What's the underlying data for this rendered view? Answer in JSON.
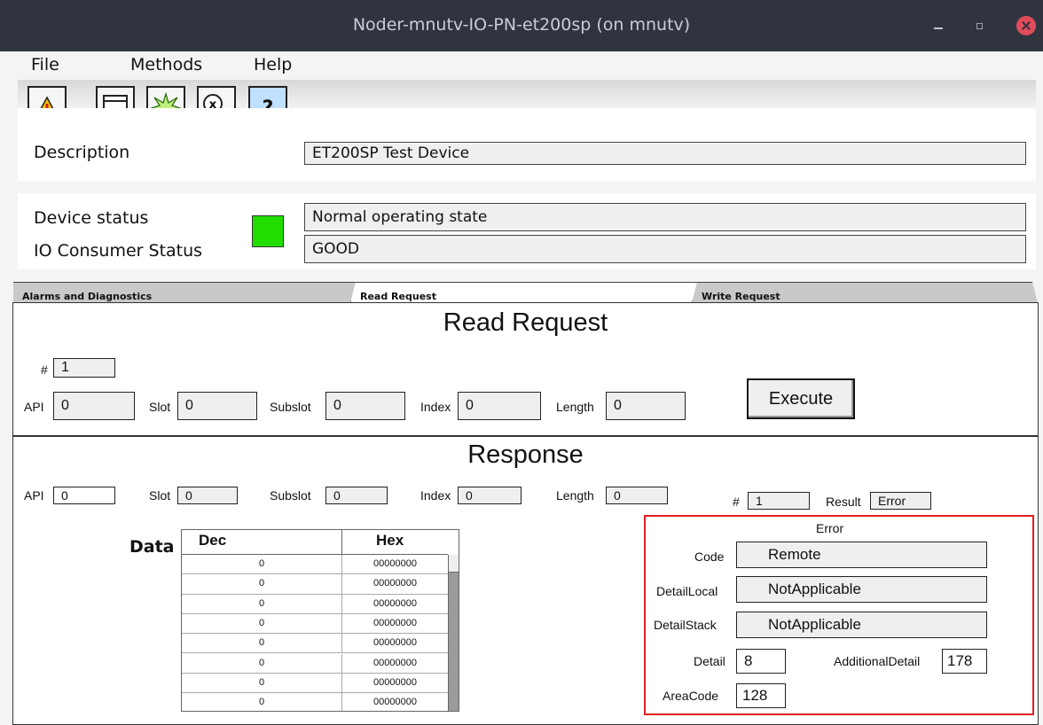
{
  "window": {
    "title": "Noder-mnutv-IO-PN-et200sp (on mnutv)"
  },
  "menu": [
    "File",
    "Methods",
    "Help"
  ],
  "toolbar": [
    {
      "name": "warning-icon"
    },
    {
      "name": "window-icon"
    },
    {
      "name": "star-burst-icon"
    },
    {
      "name": "zoom-x-icon"
    },
    {
      "name": "help-icon"
    }
  ],
  "description": {
    "label": "Description",
    "value": "ET200SP Test Device"
  },
  "status": {
    "device_label": "Device status",
    "device_value": "Normal operating state",
    "consumer_label": "IO Consumer Status",
    "consumer_value": "GOOD",
    "indicator_color": "#22dd00"
  },
  "tabs": [
    "Alarms and Diagnostics",
    "Read Request",
    "Write Request"
  ],
  "read_request": {
    "title": "Read Request",
    "num_label": "#",
    "num_value": "1",
    "api_label": "API",
    "api_value": "0",
    "slot_label": "Slot",
    "slot_value": "0",
    "subslot_label": "Subslot",
    "subslot_value": "0",
    "index_label": "Index",
    "index_value": "0",
    "length_label": "Length",
    "length_value": "0",
    "execute_label": "Execute"
  },
  "response": {
    "title": "Response",
    "api_label": "API",
    "api_value": "0",
    "slot_label": "Slot",
    "slot_value": "0",
    "subslot_label": "Subslot",
    "subslot_value": "0",
    "index_label": "Index",
    "index_value": "0",
    "length_label": "Length",
    "length_value": "0",
    "num_label": "#",
    "num_value": "1",
    "result_label": "Result",
    "result_value": "Error",
    "data_label": "Data",
    "columns": [
      "Dec",
      "Hex"
    ],
    "rows": [
      [
        "0",
        "00000000"
      ],
      [
        "0",
        "00000000"
      ],
      [
        "0",
        "00000000"
      ],
      [
        "0",
        "00000000"
      ],
      [
        "0",
        "00000000"
      ],
      [
        "0",
        "00000000"
      ],
      [
        "0",
        "00000000"
      ],
      [
        "0",
        "00000000"
      ]
    ]
  },
  "error": {
    "title": "Error",
    "code_label": "Code",
    "code_value": "Remote",
    "detail_local_label": "DetailLocal",
    "detail_local_value": "NotApplicable",
    "detail_stack_label": "DetailStack",
    "detail_stack_value": "NotApplicable",
    "detail_label": "Detail",
    "detail_value": "8",
    "additional_label": "AdditionalDetail",
    "additional_value": "178",
    "area_label": "AreaCode",
    "area_value": "128",
    "border_color": "#e02020"
  }
}
